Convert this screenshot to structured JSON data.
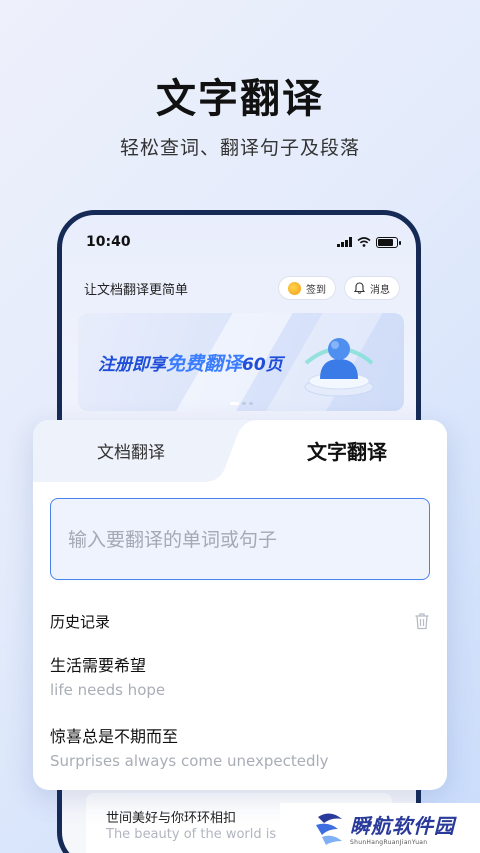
{
  "hero": {
    "title": "文字翻译",
    "subtitle": "轻松查词、翻译句子及段落"
  },
  "status_bar": {
    "time": "10:40"
  },
  "app_header": {
    "slogan": "让文档翻译更简单",
    "signin_label": "签到",
    "messages_label": "消息"
  },
  "banner": {
    "text_prefix": "注册即享",
    "text_highlight": "免费翻译",
    "text_suffix": "60页"
  },
  "card": {
    "tabs": [
      {
        "label": "文档翻译",
        "active": false
      },
      {
        "label": "文字翻译",
        "active": true
      }
    ],
    "input_placeholder": "输入要翻译的单词或句子",
    "history_title": "历史记录",
    "history": [
      {
        "source": "生活需要希望",
        "translation": "life needs hope"
      },
      {
        "source": "惊喜总是不期而至",
        "translation": "Surprises always come unexpectedly"
      }
    ]
  },
  "background_history": {
    "source": "世间美好与你环环相扣",
    "translation": "The beauty of the world is l"
  },
  "watermark": {
    "name": "瞬航软件园",
    "pinyin": "ShunHangRuanJianYuan"
  },
  "colors": {
    "accent": "#4a83f0",
    "banner_text": "#1f4fd8",
    "phone_frame": "#152a55"
  }
}
